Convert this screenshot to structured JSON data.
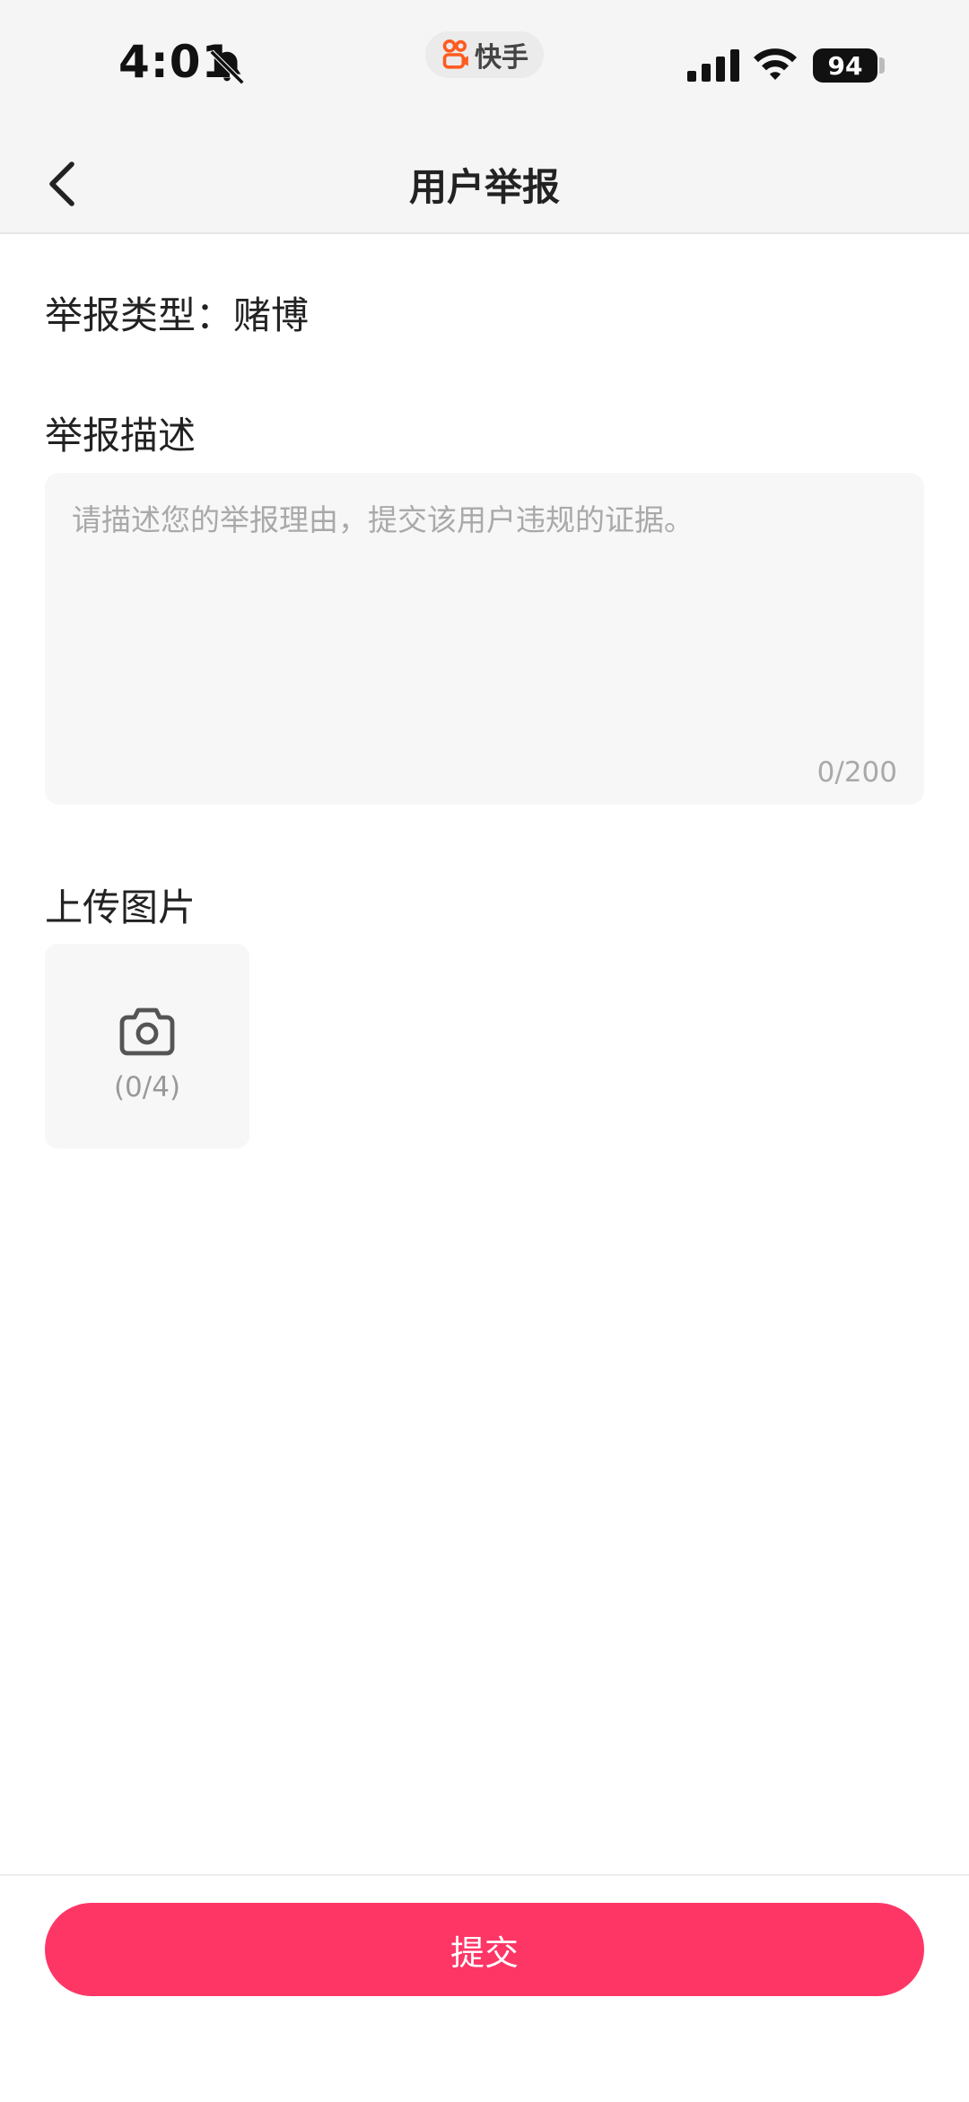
{
  "status_bar": {
    "time": "4:01",
    "app_name": "快手",
    "battery": "94"
  },
  "nav": {
    "title": "用户举报"
  },
  "report_type": {
    "label": "举报类型：",
    "value": "赌博"
  },
  "description": {
    "label": "举报描述",
    "placeholder": "请描述您的举报理由，提交该用户违规的证据。",
    "counter": "0/200"
  },
  "upload": {
    "label": "上传图片",
    "count": "(0/4)"
  },
  "footer": {
    "submit_label": "提交"
  },
  "colors": {
    "accent": "#fe3666",
    "brand": "#ff5b1f"
  }
}
